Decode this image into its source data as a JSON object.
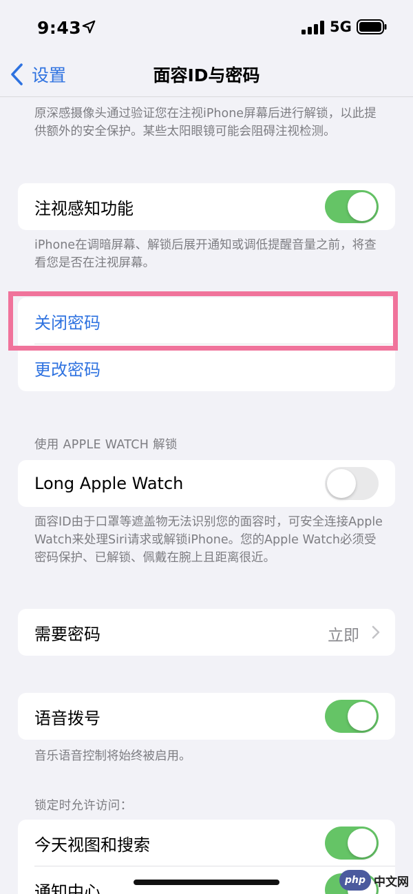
{
  "status_bar": {
    "time": "9:43",
    "network": "5G"
  },
  "nav": {
    "back_label": "设置",
    "title": "面容ID与密码"
  },
  "footnotes": {
    "attention_intro": "原深感摄像头通过验证您在注视iPhone屏幕后进行解锁，以此提供额外的安全保护。某些太阳眼镜可能会阻碍注视检测。",
    "attention_aware": "iPhone在调暗屏幕、解锁后展开通知或调低提醒音量之前，将查看您是否在注视屏幕。",
    "apple_watch": "面容ID由于口罩等遮盖物无法识别您的面容时，可安全连接Apple Watch来处理Siri请求或解锁iPhone。您的Apple Watch必须受密码保护、已解锁、佩戴在腕上且距离很近。",
    "voice_dial": "音乐语音控制将始终被启用。"
  },
  "rows": {
    "attention_aware": {
      "label": "注视感知功能",
      "on": true
    },
    "turn_off_passcode": {
      "label": "关闭密码"
    },
    "change_passcode": {
      "label": "更改密码"
    },
    "apple_watch": {
      "label": "Long Apple Watch",
      "on": false
    },
    "require_passcode": {
      "label": "需要密码",
      "value": "立即"
    },
    "voice_dial": {
      "label": "语音拨号",
      "on": true
    },
    "today_view": {
      "label": "今天视图和搜索",
      "on": true
    },
    "notification_center": {
      "label": "通知中心",
      "on": true
    }
  },
  "section_headers": {
    "unlock_with_watch": "使用 APPLE WATCH 解锁",
    "allow_access_locked": "锁定时允许访问："
  },
  "watermark": {
    "badge": "php",
    "text": "中文网"
  },
  "colors": {
    "accent_blue": "#2e72e0",
    "toggle_on": "#65c466",
    "toggle_off": "#e9e9ea",
    "highlight": "#f0739b",
    "background": "#f2f2f7"
  }
}
